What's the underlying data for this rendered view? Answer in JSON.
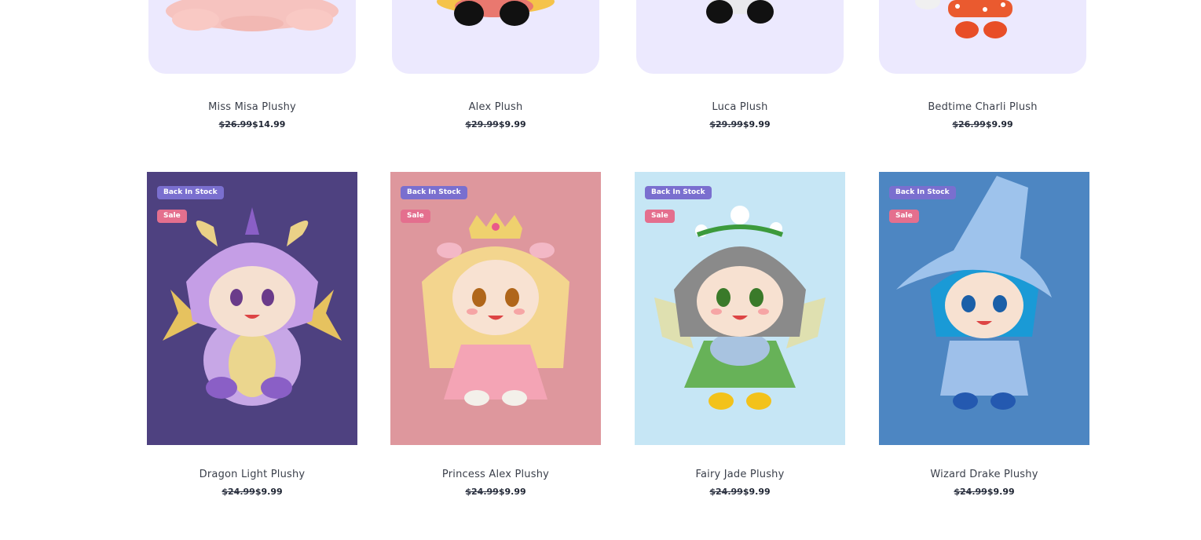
{
  "top_row": [
    {
      "title": "Miss Misa Plushy",
      "old_price": "$26.99",
      "price": "$14.99"
    },
    {
      "title": "Alex Plush",
      "old_price": "$29.99",
      "price": "$9.99"
    },
    {
      "title": "Luca Plush",
      "old_price": "$29.99",
      "price": "$9.99"
    },
    {
      "title": "Bedtime Charli Plush",
      "old_price": "$26.99",
      "price": "$9.99"
    }
  ],
  "bottom_row": [
    {
      "title": "Dragon Light Plushy",
      "old_price": "$24.99",
      "price": "$9.99",
      "badge_stock": "Back In Stock",
      "badge_sale": "Sale",
      "bg": "#4e4180"
    },
    {
      "title": "Princess Alex Plushy",
      "old_price": "$24.99",
      "price": "$9.99",
      "badge_stock": "Back In Stock",
      "badge_sale": "Sale",
      "bg": "#de979d"
    },
    {
      "title": "Fairy Jade Plushy",
      "old_price": "$24.99",
      "price": "$9.99",
      "badge_stock": "Back In Stock",
      "badge_sale": "Sale",
      "bg": "#c6e6f5"
    },
    {
      "title": "Wizard Drake Plushy",
      "old_price": "$24.99",
      "price": "$9.99",
      "badge_stock": "Back In Stock",
      "badge_sale": "Sale",
      "bg": "#4d86c2"
    }
  ],
  "colors": {
    "top_card_bg": "#ece9fe",
    "badge_stock": "#7a6fcf",
    "badge_sale": "#e46f8e"
  }
}
